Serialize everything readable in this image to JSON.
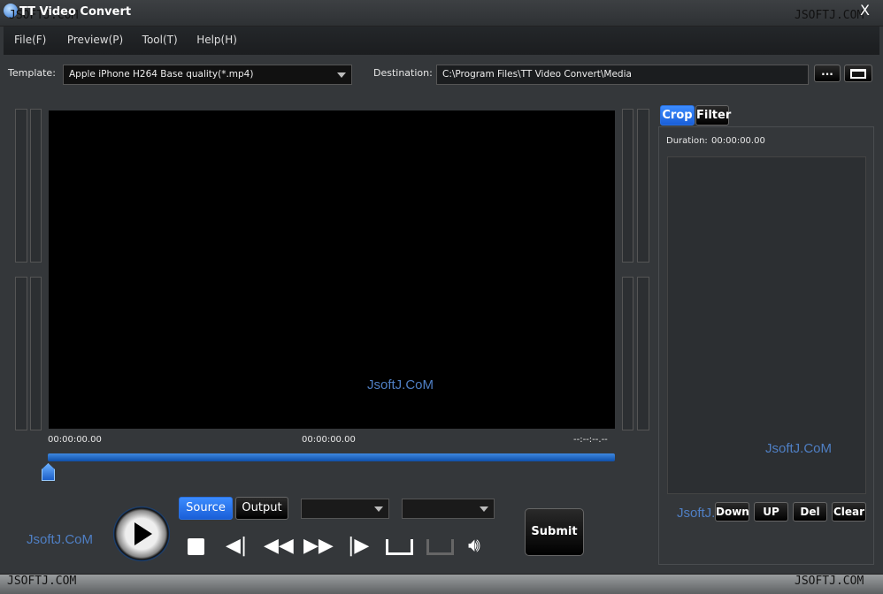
{
  "app": {
    "title": "TT Video Convert",
    "close": "X"
  },
  "watermarks": {
    "corner": "JSOFTJ.COM",
    "overlay": "JsoftJ.CoM"
  },
  "menu": [
    "File(F)",
    "Preview(P)",
    "Tool(T)",
    "Help(H)"
  ],
  "template": {
    "label": "Template:",
    "value": "Apple iPhone H264 Base quality(*.mp4)"
  },
  "destination": {
    "label": "Destination:",
    "value": "C:\\Program Files\\TT Video Convert\\Media",
    "browse": "...",
    "folder_icon": "folder-open-icon"
  },
  "timeline": {
    "start": "00:00:00.00",
    "current": "00:00:00.00",
    "end": "--:--:--.--",
    "progress": 0
  },
  "view_tabs": {
    "source": "Source",
    "output": "Output",
    "active": "Source"
  },
  "submit": "Submit",
  "side_tabs": {
    "crop": "Crop",
    "filter": "Filter",
    "active": "Crop"
  },
  "duration": {
    "label": "Duration:",
    "value": "00:00:00.00"
  },
  "list_buttons": [
    "Down",
    "UP",
    "Del",
    "Clear"
  ],
  "colors": {
    "accent": "#2a70e0",
    "background": "#34373a"
  }
}
